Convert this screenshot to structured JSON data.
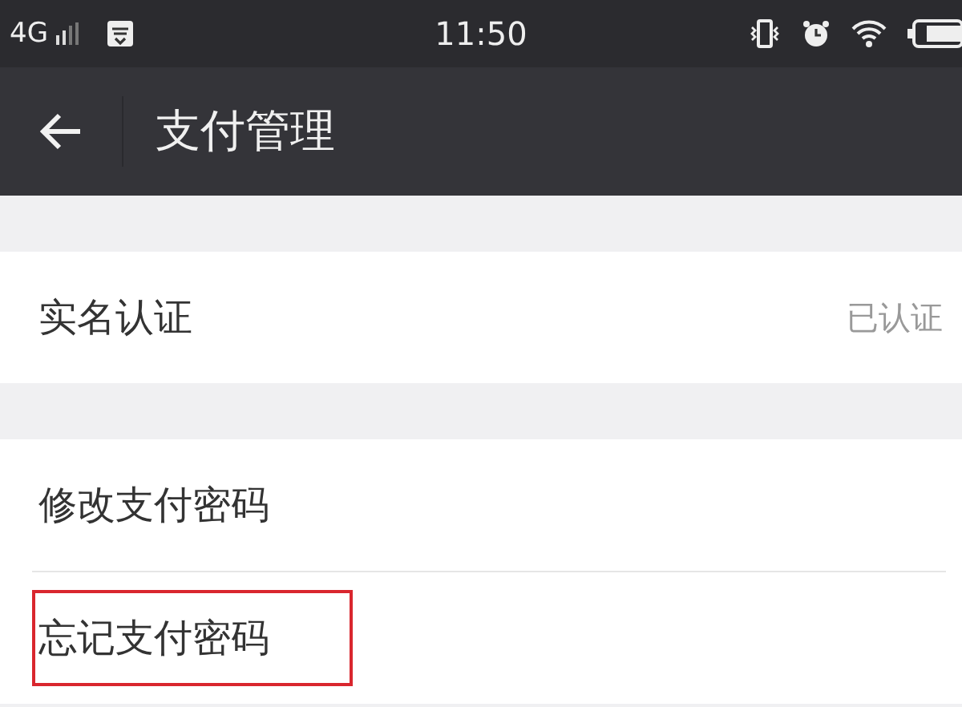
{
  "status_bar": {
    "network": "4G",
    "time": "11:50"
  },
  "nav_bar": {
    "title": "支付管理"
  },
  "groups": [
    {
      "items": [
        {
          "label": "实名认证",
          "value": "已认证",
          "highlighted": false
        }
      ]
    },
    {
      "items": [
        {
          "label": "修改支付密码",
          "highlighted": false
        },
        {
          "label": "忘记支付密码",
          "highlighted": true
        }
      ]
    }
  ]
}
